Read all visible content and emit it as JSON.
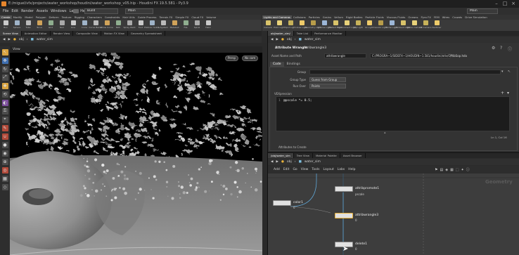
{
  "window": {
    "path": "E:/miguel/vfx/projects/water_workshop/houdini/water_workshop_v05.hip",
    "title": "Houdini FX 19.5.581 - Py3.9"
  },
  "menu": {
    "items": [
      "File",
      "Edit",
      "Render",
      "Assets",
      "Windows",
      "Labs",
      "Help"
    ],
    "desktop": "Build",
    "context": "Main",
    "right_combo": "Main"
  },
  "shelf_left": {
    "tabs": [
      "Create",
      "Modify",
      "Model",
      "Polygon",
      "Deform",
      "Texture",
      "Rigging",
      "Characters",
      "Constraints",
      "Hair Utils",
      "Guide Process",
      "Terrain FX",
      "Simple FX",
      "Cloud FX",
      "Volume"
    ],
    "tools": [
      "Box",
      "Sphere",
      "Tube",
      "Torus",
      "Grid",
      "Null",
      "Line",
      "Circle",
      "Curve Bezier",
      "Draw Curve",
      "Path",
      "Spray Paint",
      "Font",
      "Platonic Solids",
      "L-System",
      "Metaball",
      "File",
      "Spiral",
      "Helix"
    ]
  },
  "shelf_right": {
    "tabs": [
      "Lights and Cameras",
      "Collisions",
      "Particles",
      "Grains",
      "Vellum",
      "Rigid Bodies",
      "Particle Fluids",
      "Viscous Fluids",
      "Oceans",
      "Pyro FX",
      "FEM",
      "Wires",
      "Crowds",
      "Drive Simulation"
    ],
    "tools": [
      "Camera",
      "Point Light",
      "Spot Light",
      "Area Light",
      "Geometry Light",
      "Volume Light",
      "Distant Light",
      "Environment Light",
      "Sky Light",
      "GI Light",
      "Caustic Light",
      "Portal Light",
      "Ambient Light",
      "Stereo Camera",
      "VR Camera",
      "Switcher"
    ]
  },
  "left_pane": {
    "tabs": [
      "Scene View",
      "Animation Editor",
      "Render View",
      "Composite View",
      "Motion FX View",
      "Geometry Spreadsheet"
    ],
    "path": [
      "obj",
      "water_sim"
    ],
    "view_label": "View",
    "persp": "Persp",
    "cam": "No cam"
  },
  "params_pane": {
    "tabs": [
      "obj/water_sim/",
      "Take List",
      "Performance Monitor"
    ],
    "path": [
      "obj",
      "water_sim"
    ],
    "node_type": "Attribute Wrangle",
    "node_name": "attribwrangle3",
    "asset_label": "Asset Name and Path",
    "asset_name": "attribwrangle",
    "asset_path": "C:/PROGRA~1/SIDEFX~1/HOUDIN~1.581/houdini/otls/OPlibSop.hda",
    "sub_tabs": [
      "Code",
      "Bindings"
    ],
    "group_label": "Group",
    "group_type_label": "Group Type",
    "group_type_value": "Guess from Group",
    "run_over_label": "Run Over",
    "run_over_value": "Points",
    "vex_label": "VEXpression",
    "code_line_no": "1",
    "code": "@pscale *= 0.5;",
    "status": "Ln 1, Col 16",
    "attr_create_label": "Attributes to Create"
  },
  "network_pane": {
    "tabs": [
      "/obj/water_sim",
      "Tree View",
      "Material Palette",
      "Asset Browser"
    ],
    "path": [
      "obj",
      "water_sim"
    ],
    "menu": [
      "Add",
      "Edit",
      "Go",
      "View",
      "Tools",
      "Layout",
      "Labs",
      "Help"
    ],
    "context_watermark": "Geometry",
    "nodes": [
      {
        "name": "attribpromote1",
        "sub": "pscale"
      },
      {
        "name": "color1",
        "sub": "0"
      },
      {
        "name": "attribwrangle3",
        "sub": "0"
      },
      {
        "name": "delete1",
        "sub": "0"
      }
    ]
  },
  "colors": {
    "accent": "#e8b23a",
    "shelf_highlight": "#d9a441",
    "node_body": "#e1e1e1",
    "network_bg": "#3d3d3d",
    "wire_blue": "#5fa6d6"
  }
}
